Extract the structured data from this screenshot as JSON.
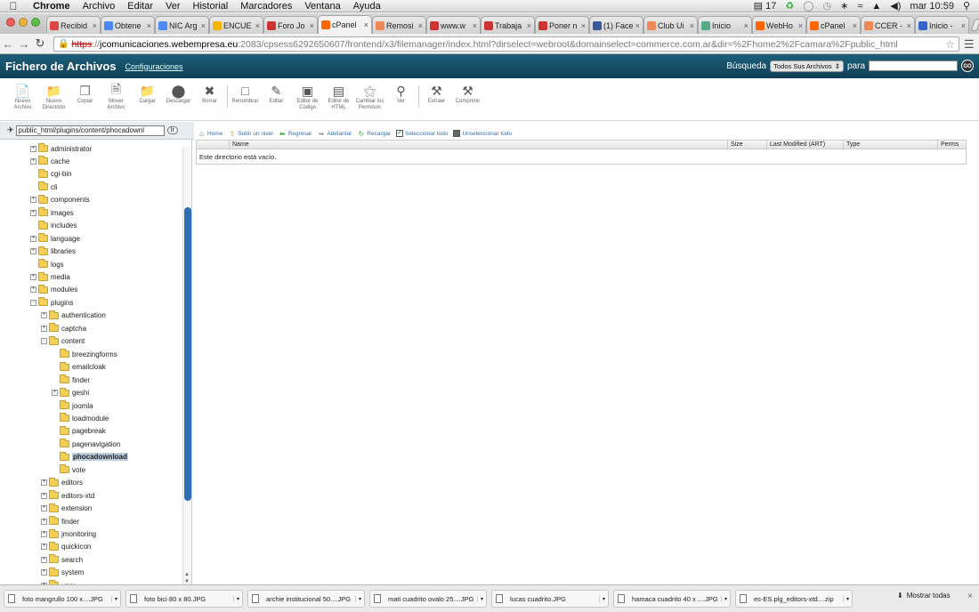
{
  "menubar": {
    "items": [
      "Chrome",
      "Archivo",
      "Editar",
      "Ver",
      "Historial",
      "Marcadores",
      "Ventana",
      "Ayuda"
    ],
    "status_num": "17",
    "clock": "mar 10:59"
  },
  "tabs": [
    {
      "label": "Recibid",
      "favicon": "gmail",
      "color": "#d44"
    },
    {
      "label": "Obtene",
      "favicon": "google",
      "color": "#4a8af4"
    },
    {
      "label": "NIC Arg",
      "favicon": "nic",
      "color": "#4a8af4"
    },
    {
      "label": "ENCUE",
      "favicon": "drive",
      "color": "#f4b400"
    },
    {
      "label": "Foro Jo",
      "favicon": "webempresa",
      "color": "#c33"
    },
    {
      "label": "cPanel",
      "favicon": "cpanel",
      "color": "#f60",
      "active": true
    },
    {
      "label": "Remosi",
      "favicon": "joomla",
      "color": "#e85"
    },
    {
      "label": "www.w",
      "favicon": "webempresa",
      "color": "#c33"
    },
    {
      "label": "Trabaja",
      "favicon": "webempresa",
      "color": "#c33"
    },
    {
      "label": "Poner n",
      "favicon": "webempresa",
      "color": "#c33"
    },
    {
      "label": "(1) Face",
      "favicon": "facebook",
      "color": "#3b5998"
    },
    {
      "label": "Club Ui",
      "favicon": "joomla",
      "color": "#e85"
    },
    {
      "label": "Inicio",
      "favicon": "globe",
      "color": "#5a8"
    },
    {
      "label": "WebHo",
      "favicon": "cpanel",
      "color": "#f60"
    },
    {
      "label": "cPanel",
      "favicon": "cpanel",
      "color": "#f60"
    },
    {
      "label": "CCER -",
      "favicon": "joomla",
      "color": "#e85"
    },
    {
      "label": "Inicio -",
      "favicon": "wiki",
      "color": "#36c"
    }
  ],
  "address": {
    "scheme": "https",
    "host": "jcomunicaciones.webempresa.eu",
    "rest": ":2083/cpsess6292650607/frontend/x3/filemanager/index.html?dirselect=webroot&domainselect=commerce.com.ar&dir=%2Fhome2%2Fcamara%2Fpublic_html"
  },
  "header": {
    "title": "Fichero de Archivos",
    "settings_link": "Configuraciones",
    "search_label": "Búsqueda",
    "search_scope": "Todos Sus Archivos",
    "for_label": "para",
    "search_value": "",
    "go_label": "GO"
  },
  "toolbar": [
    {
      "label": "Nuevo Archivo",
      "icon": "new-file-icon"
    },
    {
      "label": "Nuevo Directorio",
      "icon": "new-folder-icon"
    },
    {
      "label": "Copiar",
      "icon": "copy-icon"
    },
    {
      "label": "Mover Archivo",
      "icon": "move-icon"
    },
    {
      "label": "Cargar",
      "icon": "upload-icon"
    },
    {
      "label": "Descargar",
      "icon": "download-icon"
    },
    {
      "label": "Borrar",
      "icon": "delete-icon"
    },
    {
      "label": "Renombrar",
      "icon": "rename-icon"
    },
    {
      "label": "Editar",
      "icon": "edit-icon"
    },
    {
      "label": "Editor de Código",
      "icon": "code-editor-icon"
    },
    {
      "label": "Editor de HTML",
      "icon": "html-editor-icon"
    },
    {
      "label": "Cambiar los Permisos",
      "icon": "permissions-icon"
    },
    {
      "label": "Ver",
      "icon": "view-icon"
    },
    {
      "label": "Extraer",
      "icon": "extract-icon"
    },
    {
      "label": "Comprimir",
      "icon": "compress-icon"
    }
  ],
  "path": {
    "value": "public_html/plugins/content/phocadownl",
    "go_label": "Ir"
  },
  "navbar": {
    "home": "Home",
    "up": "Subir un nivel",
    "back": "Regresar",
    "forward": "Adelantar",
    "reload": "Recargar",
    "select_all": "Seleccionar todo",
    "unselect_all": "Unseleccionar todo"
  },
  "table": {
    "columns": [
      "Name",
      "Size",
      "Last Modified (ART)",
      "Type",
      "Perms"
    ],
    "empty_message": "Este directorio está vacío."
  },
  "tree": [
    {
      "label": "administrator",
      "depth": 0,
      "expand": "+"
    },
    {
      "label": "cache",
      "depth": 0,
      "expand": "+"
    },
    {
      "label": "cgi-bin",
      "depth": 0,
      "expand": ""
    },
    {
      "label": "cli",
      "depth": 0,
      "expand": ""
    },
    {
      "label": "components",
      "depth": 0,
      "expand": "+"
    },
    {
      "label": "images",
      "depth": 0,
      "expand": "+"
    },
    {
      "label": "includes",
      "depth": 0,
      "expand": ""
    },
    {
      "label": "language",
      "depth": 0,
      "expand": "+"
    },
    {
      "label": "libraries",
      "depth": 0,
      "expand": "+"
    },
    {
      "label": "logs",
      "depth": 0,
      "expand": ""
    },
    {
      "label": "media",
      "depth": 0,
      "expand": "+"
    },
    {
      "label": "modules",
      "depth": 0,
      "expand": "+"
    },
    {
      "label": "plugins",
      "depth": 0,
      "expand": "-"
    },
    {
      "label": "authentication",
      "depth": 1,
      "expand": "+"
    },
    {
      "label": "captcha",
      "depth": 1,
      "expand": "+"
    },
    {
      "label": "content",
      "depth": 1,
      "expand": "-"
    },
    {
      "label": "breezingforms",
      "depth": 2,
      "expand": ""
    },
    {
      "label": "emailcloak",
      "depth": 2,
      "expand": ""
    },
    {
      "label": "finder",
      "depth": 2,
      "expand": ""
    },
    {
      "label": "geshi",
      "depth": 2,
      "expand": "+"
    },
    {
      "label": "joomla",
      "depth": 2,
      "expand": ""
    },
    {
      "label": "loadmodule",
      "depth": 2,
      "expand": ""
    },
    {
      "label": "pagebreak",
      "depth": 2,
      "expand": ""
    },
    {
      "label": "pagenavigation",
      "depth": 2,
      "expand": ""
    },
    {
      "label": "phocadownload",
      "depth": 2,
      "expand": "",
      "selected": true
    },
    {
      "label": "vote",
      "depth": 2,
      "expand": ""
    },
    {
      "label": "editors",
      "depth": 1,
      "expand": "+"
    },
    {
      "label": "editors-xtd",
      "depth": 1,
      "expand": "+"
    },
    {
      "label": "extension",
      "depth": 1,
      "expand": "+"
    },
    {
      "label": "finder",
      "depth": 1,
      "expand": "+"
    },
    {
      "label": "jmonitoring",
      "depth": 1,
      "expand": "+"
    },
    {
      "label": "quickicon",
      "depth": 1,
      "expand": "+"
    },
    {
      "label": "search",
      "depth": 1,
      "expand": "+"
    },
    {
      "label": "system",
      "depth": 1,
      "expand": "+"
    },
    {
      "label": "user",
      "depth": 1,
      "expand": "+"
    }
  ],
  "downloads": {
    "items": [
      "foto mangrullo 100  x....JPG",
      "foto bici 80  x 80.JPG",
      "archie institucional 50....JPG",
      "mati cuadrito ovalo 25....JPG",
      "lucas cuadrito.JPG",
      "hamaca cuadrito 40 x ....JPG",
      "es-ES.plg_editors-xtd....zip"
    ],
    "show_all": "Mostrar todas"
  }
}
